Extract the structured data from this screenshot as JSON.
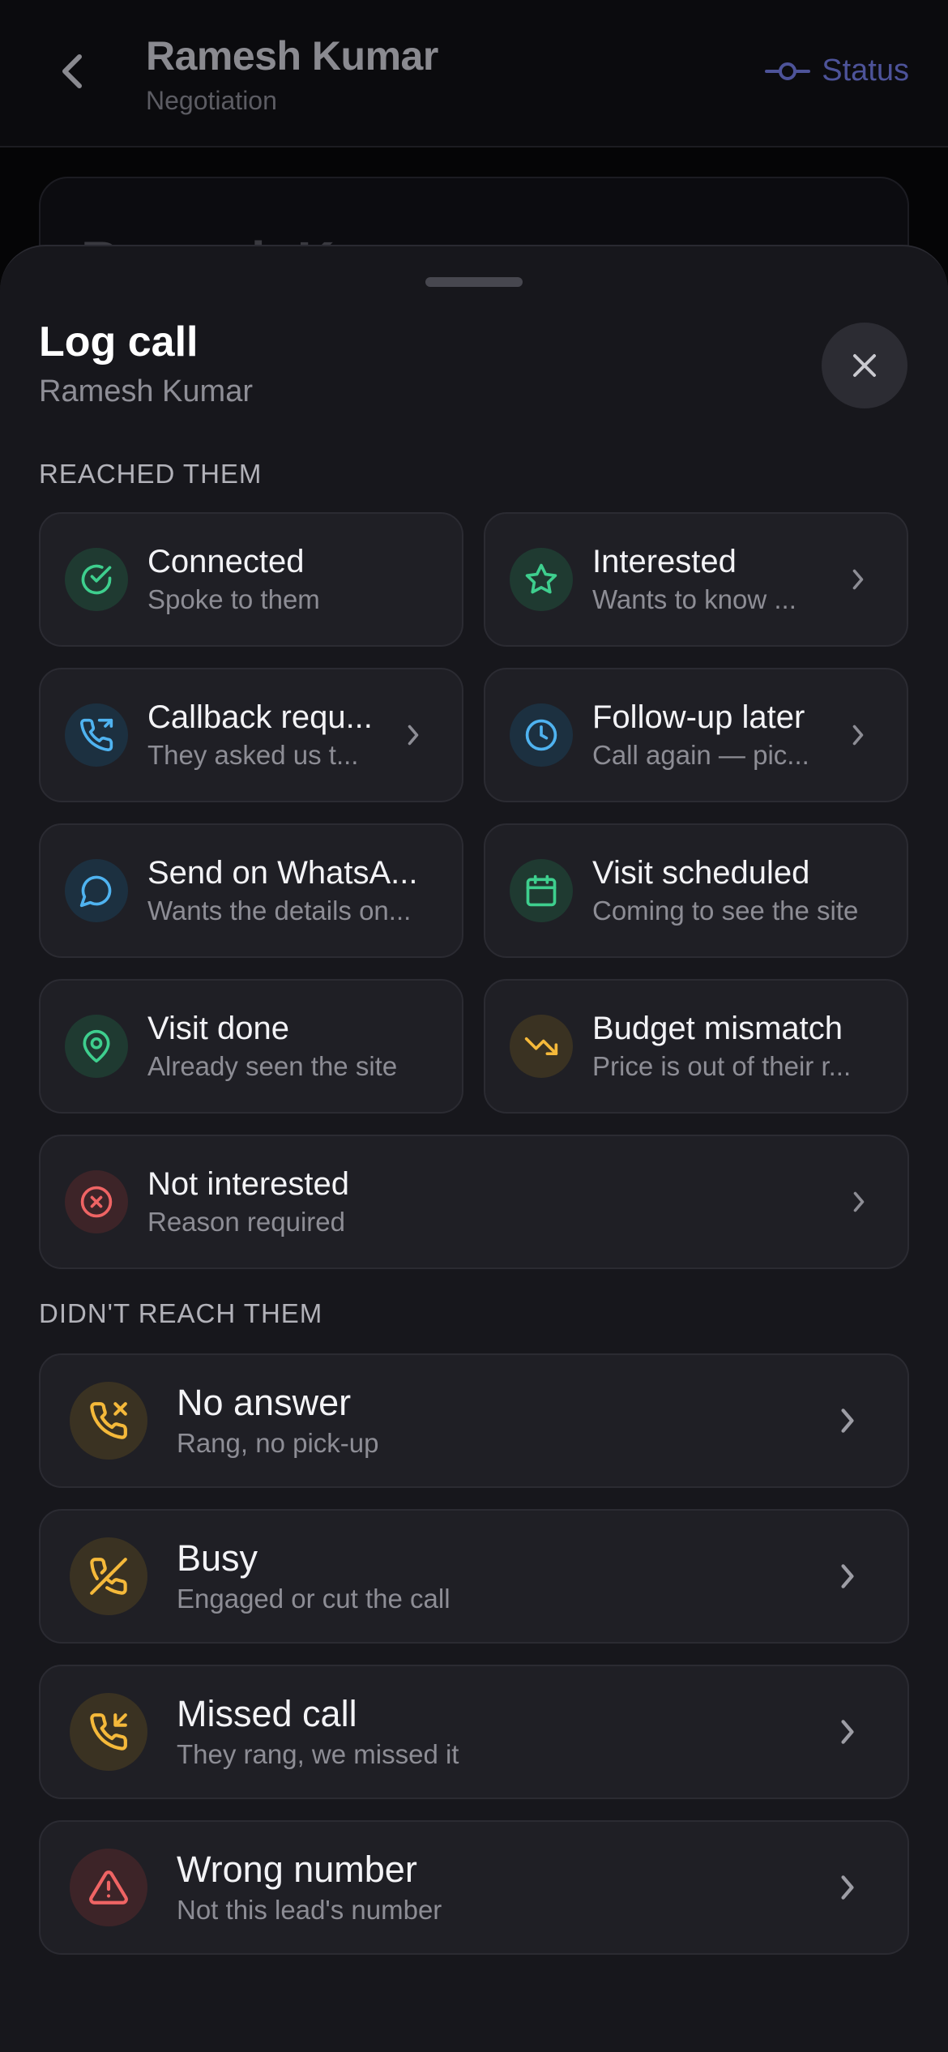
{
  "background": {
    "title": "Ramesh Kumar",
    "subtitle": "Negotiation",
    "status_label": "Status",
    "card_name": "Ramesh Kumar"
  },
  "sheet": {
    "title": "Log call",
    "subtitle": "Ramesh Kumar",
    "reached_label": "REACHED THEM",
    "not_reached_label": "DIDN'T REACH THEM",
    "reached": [
      {
        "title": "Connected",
        "desc": "Spoke to them",
        "icon": "check-circle-icon",
        "color": "#3ecf8e"
      },
      {
        "title": "Interested",
        "desc": "Wants to know ...",
        "icon": "star-icon",
        "color": "#3ecf8e"
      },
      {
        "title": "Callback requ...",
        "desc": "They asked us t...",
        "icon": "phone-forward-icon",
        "color": "#4fb3f0"
      },
      {
        "title": "Follow-up later",
        "desc": "Call again — pic...",
        "icon": "clock-icon",
        "color": "#4fb3f0"
      },
      {
        "title": "Send on WhatsA...",
        "desc": "Wants the details on...",
        "icon": "chat-bubble-icon",
        "color": "#4fb3f0"
      },
      {
        "title": "Visit scheduled",
        "desc": "Coming to see the site",
        "icon": "calendar-icon",
        "color": "#3ecf8e"
      },
      {
        "title": "Visit done",
        "desc": "Already seen the site",
        "icon": "map-pin-icon",
        "color": "#3ecf8e"
      },
      {
        "title": "Budget mismatch",
        "desc": "Price is out of their r...",
        "icon": "trending-down-icon",
        "color": "#f5b93a"
      },
      {
        "title": "Not interested",
        "desc": "Reason required",
        "icon": "x-circle-icon",
        "color": "#ef6464"
      }
    ],
    "not_reached": [
      {
        "title": "No answer",
        "desc": "Rang, no pick-up",
        "icon": "phone-x-icon",
        "color": "#f5b93a"
      },
      {
        "title": "Busy",
        "desc": "Engaged or cut the call",
        "icon": "phone-off-icon",
        "color": "#f5b93a"
      },
      {
        "title": "Missed call",
        "desc": "They rang, we missed it",
        "icon": "phone-incoming-icon",
        "color": "#f5b93a"
      },
      {
        "title": "Wrong number",
        "desc": "Not this lead's number",
        "icon": "warning-triangle-icon",
        "color": "#ef6464"
      }
    ]
  },
  "colors": {
    "accent_status": "#4d5399",
    "sheet_bg": "#17171c",
    "card_bg": "#1f1f25"
  }
}
